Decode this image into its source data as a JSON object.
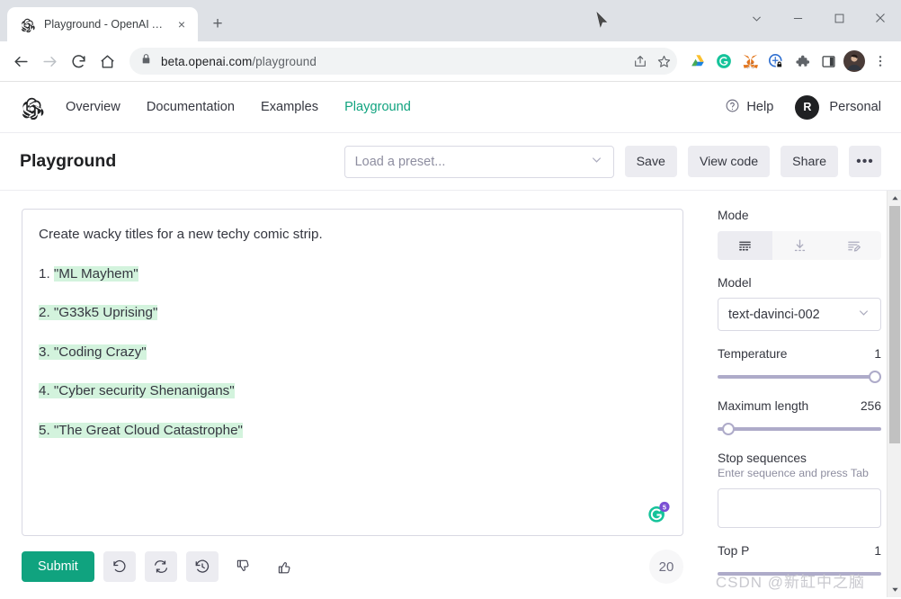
{
  "browser": {
    "tab": {
      "title": "Playground - OpenAI API",
      "favicon": "openai-logo-icon",
      "close": "×"
    },
    "newtab_label": "+",
    "window_controls": {
      "tab_search": "tab-search-icon",
      "minimize": "minimize-icon",
      "maximize": "maximize-icon",
      "close": "close-icon"
    },
    "nav": {
      "back": "back-arrow-icon",
      "forward": "forward-arrow-icon",
      "reload": "reload-icon",
      "home": "home-icon"
    },
    "omnibox": {
      "lock": "lock-icon",
      "host": "beta.openai.com",
      "path": "/playground",
      "share": "share-icon",
      "bookmark": "star-icon"
    },
    "extensions": [
      {
        "name": "google-drive-icon"
      },
      {
        "name": "grammarly-icon"
      },
      {
        "name": "metamask-icon"
      },
      {
        "name": "privacy-badger-icon"
      },
      {
        "name": "extensions-puzzle-icon"
      },
      {
        "name": "side-panel-icon"
      },
      {
        "name": "profile-avatar"
      },
      {
        "name": "chrome-menu-icon"
      }
    ]
  },
  "topnav": {
    "logo": "openai-logo-icon",
    "links": [
      {
        "label": "Overview",
        "active": false
      },
      {
        "label": "Documentation",
        "active": false
      },
      {
        "label": "Examples",
        "active": false
      },
      {
        "label": "Playground",
        "active": true
      }
    ],
    "help_label": "Help",
    "help_icon": "question-circle-icon",
    "account": {
      "initial": "R",
      "label": "Personal"
    }
  },
  "header": {
    "title": "Playground",
    "preset_placeholder": "Load a preset...",
    "buttons": {
      "save": "Save",
      "view_code": "View code",
      "share": "Share",
      "more": "•••"
    }
  },
  "editor": {
    "prompt": "Create wacky titles for a new techy comic strip.",
    "completions": [
      {
        "prefix": "1. ",
        "text": "\"ML Mayhem\"",
        "prefix_highlighted": false
      },
      {
        "prefix": "2. ",
        "text": "\"G33k5 Uprising\"",
        "prefix_highlighted": true
      },
      {
        "prefix": "3. ",
        "text": "\"Coding Crazy\"",
        "prefix_highlighted": true
      },
      {
        "prefix": "4. ",
        "text": "\"Cyber security Shenanigans\"",
        "prefix_highlighted": true
      },
      {
        "prefix": "5. ",
        "text": "\"The Great Cloud Catastrophe\"",
        "prefix_highlighted": true
      }
    ],
    "highlight_color": "#d3f3dd",
    "grammarly_badge": "5",
    "token_count": "20"
  },
  "bottombar": {
    "submit_label": "Submit",
    "undo_icon": "undo-icon",
    "regenerate_icon": "regenerate-icon",
    "history_icon": "history-clock-icon",
    "thumbs_down_icon": "thumbs-down-icon",
    "thumbs_up_icon": "thumbs-up-icon"
  },
  "sidebar": {
    "mode": {
      "label": "Mode",
      "options": [
        {
          "name": "complete-mode-icon",
          "active": true
        },
        {
          "name": "insert-mode-icon",
          "active": false
        },
        {
          "name": "edit-mode-icon",
          "active": false
        }
      ]
    },
    "model": {
      "label": "Model",
      "value": "text-davinci-002"
    },
    "temperature": {
      "label": "Temperature",
      "value": "1",
      "percent": 100
    },
    "maximum_length": {
      "label": "Maximum length",
      "value": "256",
      "percent": 3
    },
    "stop_sequences": {
      "label": "Stop sequences",
      "hint": "Enter sequence and press Tab",
      "value": ""
    },
    "top_p": {
      "label": "Top P",
      "value": "1",
      "percent": 100
    }
  },
  "colors": {
    "accent": "#10a37f",
    "highlight": "#d3f3dd",
    "slider": "#aeabc9",
    "text": "#353740"
  },
  "watermark": "CSDN @新缸中之脑"
}
